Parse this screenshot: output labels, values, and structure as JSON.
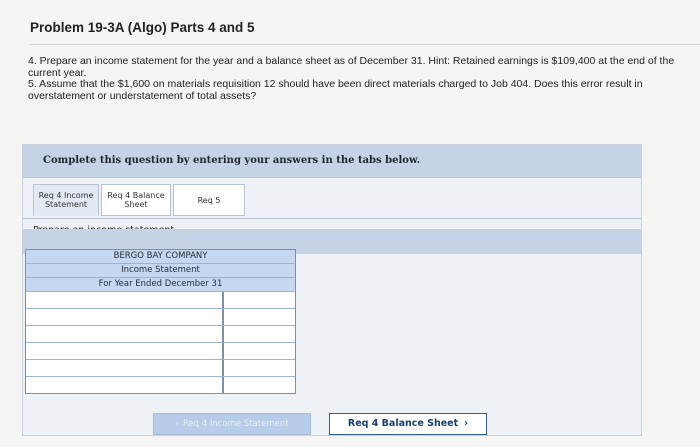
{
  "problem": {
    "title": "Problem 19-3A (Algo) Parts 4 and 5",
    "instruction_4": "4. Prepare an income statement for the year and a balance sheet as of December 31. Hint: Retained earnings is $109,400 at the end of the current year.",
    "instruction_5": "5. Assume that the $1,600 on materials requisition 12 should have been direct materials charged to Job 404. Does this error result in overstatement or understatement of total assets?"
  },
  "banner": {
    "text": "Complete this question by entering your answers in the tabs below."
  },
  "tabs": [
    {
      "label": "Req 4 Income Statement",
      "active": true
    },
    {
      "label": "Req 4 Balance Sheet",
      "active": false
    },
    {
      "label": "Req 5",
      "active": false
    }
  ],
  "prompt": "Prepare an income statement.",
  "statement": {
    "company": "BERGO BAY COMPANY",
    "name": "Income Statement",
    "period": "For Year Ended December 31",
    "rows": [
      {
        "label": "",
        "amount": ""
      },
      {
        "label": "",
        "amount": ""
      },
      {
        "label": "",
        "amount": ""
      },
      {
        "label": "",
        "amount": ""
      },
      {
        "label": "",
        "amount": ""
      },
      {
        "label": "",
        "amount": ""
      }
    ]
  },
  "nav": {
    "prev_label": "Req 4 Income Statement",
    "next_label": "Req 4 Balance Sheet"
  },
  "colors": {
    "accent": "#2f5f96",
    "panel": "#c6d3e6",
    "header": "#c6d8ef"
  }
}
